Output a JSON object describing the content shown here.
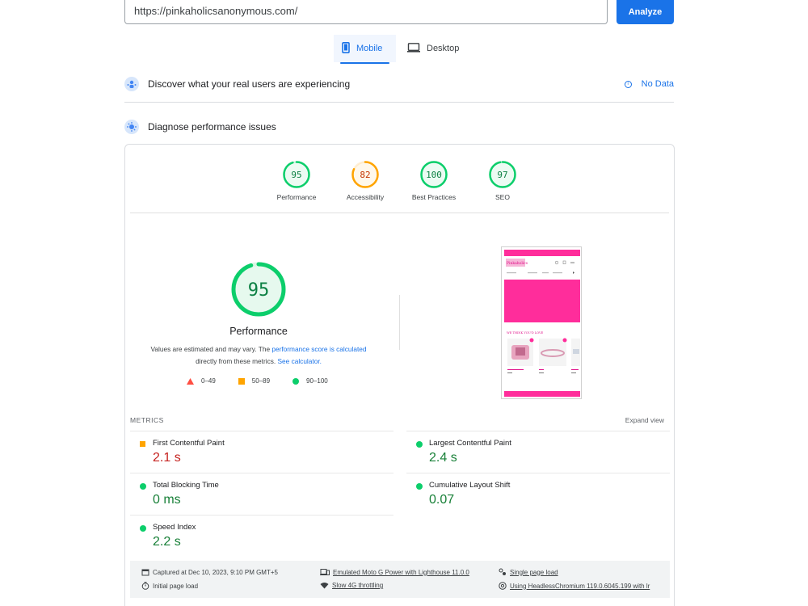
{
  "url_bar": {
    "value": "https://pinkaholicsanonymous.com/",
    "analyze_label": "Analyze"
  },
  "device_tabs": [
    {
      "label": "Mobile",
      "selected": true
    },
    {
      "label": "Desktop",
      "selected": false
    }
  ],
  "discover": {
    "title": "Discover what your real users are experiencing",
    "no_data_label": "No Data"
  },
  "diagnose": {
    "title": "Diagnose performance issues"
  },
  "categories": [
    {
      "score": "95",
      "label": "Performance",
      "color": "#0cce6b",
      "text_color": "#0c8043",
      "fill": 0.95
    },
    {
      "score": "82",
      "label": "Accessibility",
      "color": "#ffa400",
      "text_color": "#c33300",
      "fill": 0.82
    },
    {
      "score": "100",
      "label": "Best Practices",
      "color": "#0cce6b",
      "text_color": "#0c8043",
      "fill": 1.0
    },
    {
      "score": "97",
      "label": "SEO",
      "color": "#0cce6b",
      "text_color": "#0c8043",
      "fill": 0.97
    }
  ],
  "performance": {
    "score": "95",
    "fill": 0.95,
    "title": "Performance",
    "desc_prefix": "Values are estimated and may vary. The ",
    "desc_link1": "performance score is calculated",
    "desc_mid": "directly from these metrics. ",
    "desc_link2": "See calculator."
  },
  "legend": [
    {
      "range": "0–49",
      "shape": "triangle",
      "color": "#ff4e42"
    },
    {
      "range": "50–89",
      "shape": "square",
      "color": "#ffa400"
    },
    {
      "range": "90–100",
      "shape": "circle",
      "color": "#0cce6b"
    }
  ],
  "metrics_header": {
    "title": "METRICS",
    "expand_label": "Expand view"
  },
  "metrics": [
    {
      "label": "First Contentful Paint",
      "value": "2.1 s",
      "status": "orange"
    },
    {
      "label": "Largest Contentful Paint",
      "value": "2.4 s",
      "status": "green"
    },
    {
      "label": "Total Blocking Time",
      "value": "0 ms",
      "status": "green"
    },
    {
      "label": "Cumulative Layout Shift",
      "value": "0.07",
      "status": "green"
    },
    {
      "label": "Speed Index",
      "value": "2.2 s",
      "status": "green"
    }
  ],
  "screenshot_preview": {
    "section_title": "WE THINK YOU'D LOVE",
    "accent": "#ff2d9b"
  },
  "footer": {
    "captured": "Captured at Dec 10, 2023, 9:10 PM GMT+5",
    "initial_load": "Initial page load",
    "device": "Emulated Moto G Power with Lighthouse 11.0.0",
    "throttling": "Slow 4G throttling",
    "session": "Single page load",
    "browser": "Using HeadlessChromium 119.0.6045.199 with lr"
  }
}
